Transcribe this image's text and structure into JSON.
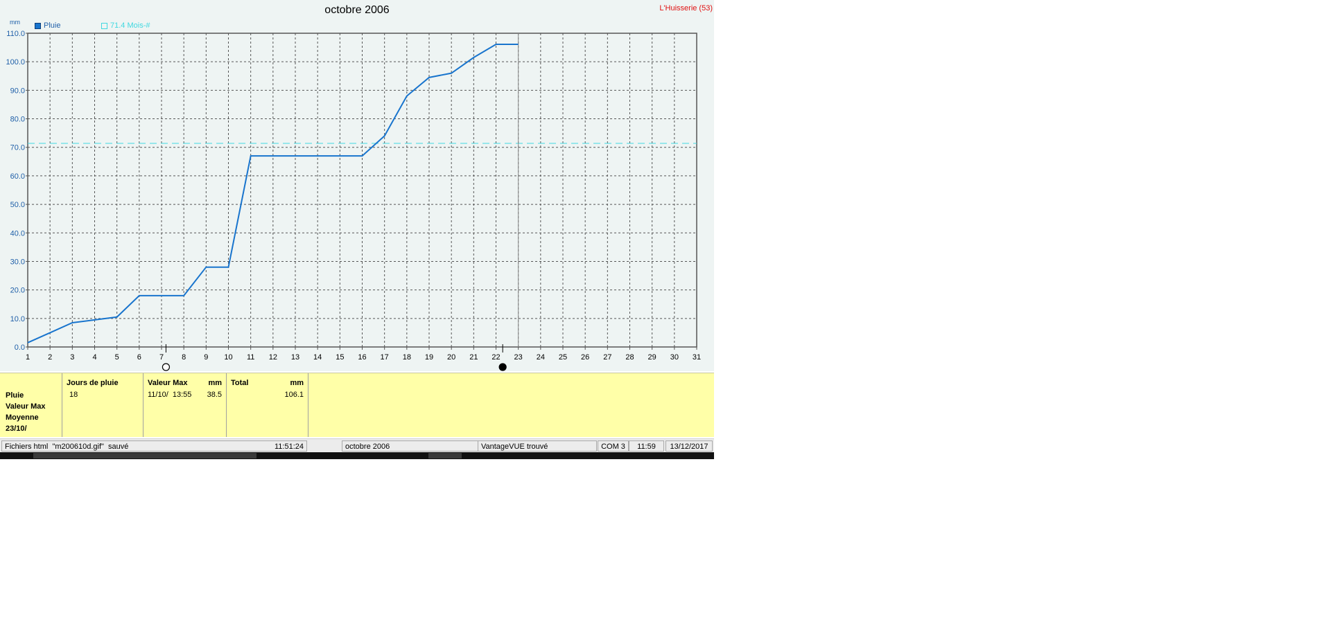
{
  "header": {
    "title": "octobre 2006",
    "station": "L'Huisserie (53)",
    "unit": "mm"
  },
  "legend": [
    {
      "label": "Pluie",
      "color": "#1874cd",
      "style": "filled"
    },
    {
      "label": "71.4 Mois-#",
      "color": "#40d8e0",
      "style": "outline"
    }
  ],
  "chart_data": {
    "type": "line",
    "title": "octobre 2006",
    "ylabel": "mm",
    "xlabel": "",
    "xlim": [
      1,
      31
    ],
    "ylim": [
      0,
      110
    ],
    "x_ticks": [
      1,
      2,
      3,
      4,
      5,
      6,
      7,
      8,
      9,
      10,
      11,
      12,
      13,
      14,
      15,
      16,
      17,
      18,
      19,
      20,
      21,
      22,
      23,
      24,
      25,
      26,
      27,
      28,
      29,
      30,
      31
    ],
    "y_ticks": [
      "0.0",
      "10.0",
      "20.0",
      "30.0",
      "40.0",
      "50.0",
      "60.0",
      "70.0",
      "80.0",
      "90.0",
      "100.0",
      "110.0"
    ],
    "grid": true,
    "series": [
      {
        "name": "Pluie",
        "color": "#1874cd",
        "points": [
          [
            1,
            1.5
          ],
          [
            2,
            5
          ],
          [
            3,
            8.5
          ],
          [
            4,
            9.5
          ],
          [
            5,
            10.5
          ],
          [
            6,
            18
          ],
          [
            7,
            18
          ],
          [
            8,
            18
          ],
          [
            9,
            28
          ],
          [
            10,
            28
          ],
          [
            11,
            67
          ],
          [
            12,
            67
          ],
          [
            13,
            67
          ],
          [
            14,
            67
          ],
          [
            15,
            67
          ],
          [
            16,
            67
          ],
          [
            17,
            74
          ],
          [
            18,
            88
          ],
          [
            19,
            94.5
          ],
          [
            20,
            96
          ],
          [
            21,
            101.5
          ],
          [
            22,
            106.1
          ],
          [
            23,
            106.1
          ]
        ]
      }
    ],
    "reference_line": {
      "name": "71.4 Mois-#",
      "value": 71.4,
      "color": "#40d8e0",
      "style": "dashed"
    },
    "current_day_marker": 23,
    "moon_phases": [
      {
        "day": 7.2,
        "phase": "full-moon"
      },
      {
        "day": 22.3,
        "phase": "new-moon"
      }
    ]
  },
  "stats": {
    "row_labels": [
      "Pluie",
      "Valeur Max",
      "Moyenne",
      "23/10/"
    ],
    "jours_header": "Jours de pluie",
    "jours_value": "18",
    "max_header": "Valeur Max",
    "max_unit": "mm",
    "max_date": "11/10/  13:55",
    "max_value": "38.5",
    "total_header": "Total",
    "total_unit": "mm",
    "total_value": "106.1"
  },
  "status_bar": {
    "message": "Fichiers html  \"m200610d.gif\"  sauvé",
    "time1": "11:51:24",
    "period": "octobre 2006",
    "device": "VantageVUE trouvé",
    "port": "COM 3",
    "time2": "11:59",
    "date": "13/12/2017"
  },
  "colors": {
    "plot_bg": "#eef4f3",
    "axis": "#555555",
    "grid": "#555555",
    "tick_label": "#1f5fa8",
    "stats_bg": "#ffffa8"
  }
}
